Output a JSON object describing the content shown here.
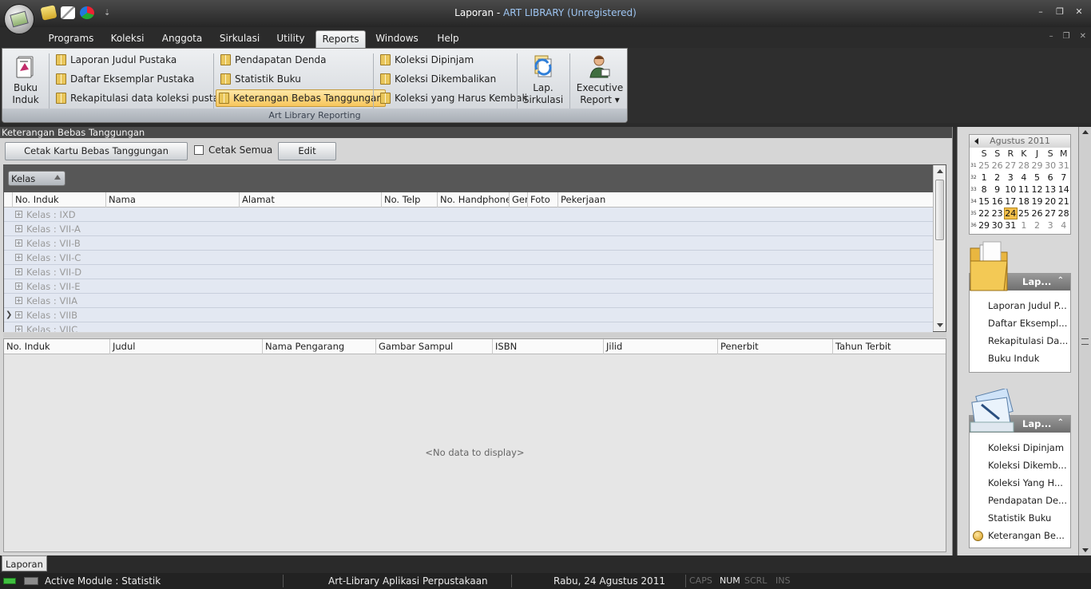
{
  "window": {
    "title_doc": "Laporan",
    "title_sep": " - ",
    "title_app": "ART LIBRARY (Unregistered)"
  },
  "quick_access": {
    "customize_label": "⇣"
  },
  "window_controls": {
    "minimize": "–",
    "restore": "❐",
    "close": "✕"
  },
  "mdi_controls": {
    "minimize": "–",
    "restore": "❐",
    "close": "✕"
  },
  "tabs": [
    {
      "label": "Programs"
    },
    {
      "label": "Koleksi"
    },
    {
      "label": "Anggota"
    },
    {
      "label": "Sirkulasi"
    },
    {
      "label": "Utility"
    },
    {
      "label": "Reports"
    },
    {
      "label": "Windows"
    },
    {
      "label": "Help"
    }
  ],
  "active_tab": "Reports",
  "ribbon": {
    "buku_induk": {
      "line1": "Buku",
      "line2": "Induk"
    },
    "col1": [
      "Laporan Judul Pustaka",
      "Daftar Eksemplar Pustaka",
      "Rekapitulasi data koleksi pustaka"
    ],
    "col2": [
      "Pendapatan Denda",
      "Statistik Buku",
      "Keterangan Bebas Tanggungan"
    ],
    "col3": [
      "Koleksi Dipinjam",
      "Koleksi Dikembalikan",
      "Koleksi yang Harus Kembali"
    ],
    "lap_sirkulasi": {
      "line1": "Lap.",
      "line2": "Sirkulasi"
    },
    "executive": {
      "line1": "Executive",
      "line2": "Report ▾"
    },
    "caption": "Art Library Reporting",
    "active_item": "Keterangan Bebas Tanggungan"
  },
  "document": {
    "title": "Keterangan Bebas Tanggungan",
    "print_button": "Cetak Kartu Bebas Tanggungan",
    "print_all_label": "Cetak Semua",
    "print_all_checked": false,
    "edit_button": "Edit",
    "group_by": "Kelas",
    "grid1_columns": [
      "No. Induk",
      "Nama",
      "Alamat",
      "No. Telp",
      "No. Handphone",
      "Gen",
      "Foto",
      "Pekerjaan"
    ],
    "groups": [
      "Kelas : IXD",
      "Kelas : VII-A",
      "Kelas : VII-B",
      "Kelas : VII-C",
      "Kelas : VII-D",
      "Kelas : VII-E",
      "Kelas : VIIA",
      "Kelas : VIIB",
      "Kelas : VIIC"
    ],
    "focused_group": "Kelas : VIIB",
    "grid2_columns": [
      "No. Induk",
      "Judul",
      "Nama Pengarang",
      "Gambar Sampul",
      "ISBN",
      "Jilid",
      "Penerbit",
      "Tahun Terbit"
    ],
    "no_data": "<No data to display>"
  },
  "doc_tab": "Laporan",
  "calendar": {
    "month_label": "Agustus 2011",
    "dow": [
      "S",
      "S",
      "R",
      "K",
      "J",
      "S",
      "M"
    ],
    "weeks": [
      {
        "wk": "31",
        "days": [
          "25",
          "26",
          "27",
          "28",
          "29",
          "30",
          "31"
        ],
        "other_month": [
          true,
          true,
          true,
          true,
          true,
          true,
          true
        ]
      },
      {
        "wk": "32",
        "days": [
          "1",
          "2",
          "3",
          "4",
          "5",
          "6",
          "7"
        ],
        "other_month": [
          false,
          false,
          false,
          false,
          false,
          false,
          false
        ]
      },
      {
        "wk": "33",
        "days": [
          "8",
          "9",
          "10",
          "11",
          "12",
          "13",
          "14"
        ],
        "other_month": [
          false,
          false,
          false,
          false,
          false,
          false,
          false
        ]
      },
      {
        "wk": "34",
        "days": [
          "15",
          "16",
          "17",
          "18",
          "19",
          "20",
          "21"
        ],
        "other_month": [
          false,
          false,
          false,
          false,
          false,
          false,
          false
        ]
      },
      {
        "wk": "35",
        "days": [
          "22",
          "23",
          "24",
          "25",
          "26",
          "27",
          "28"
        ],
        "other_month": [
          false,
          false,
          false,
          false,
          false,
          false,
          false
        ]
      },
      {
        "wk": "36",
        "days": [
          "29",
          "30",
          "31",
          "1",
          "2",
          "3",
          "4"
        ],
        "other_month": [
          false,
          false,
          false,
          true,
          true,
          true,
          true
        ]
      }
    ],
    "today": "24"
  },
  "nav_groups": [
    {
      "title": "Lap...",
      "items": [
        "Laporan Judul P...",
        "Daftar Eksempl...",
        "Rekapitulasi Da...",
        "Buku Induk"
      ]
    },
    {
      "title": "Lap...",
      "items": [
        "Koleksi Dipinjam",
        "Koleksi Dikemb...",
        "Koleksi Yang H...",
        "Pendapatan De...",
        "Statistik Buku",
        "Keterangan Be..."
      ]
    }
  ],
  "status": {
    "module": "Active Module : Statistik",
    "app_name": "Art-Library Aplikasi Perpustakaan",
    "date": "Rabu, 24 Agustus 2011",
    "indicators": [
      {
        "label": "CAPS",
        "on": false
      },
      {
        "label": "NUM",
        "on": true
      },
      {
        "label": "SCRL",
        "on": false
      },
      {
        "label": "INS",
        "on": false
      }
    ]
  },
  "colors": {
    "accent_active": "#f8c65c",
    "title_app": "#9ec5f2",
    "group_row": "#e3e8f2"
  }
}
